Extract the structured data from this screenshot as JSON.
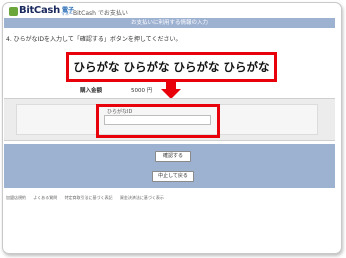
{
  "header": {
    "logo_text": "BitCash",
    "logo_sub_top": "電子",
    "logo_sub_bottom": "マネー",
    "title": "BitCash でお支払い"
  },
  "titlebar": {
    "label": "お支払いに利用する情報の入力"
  },
  "instruction": "4. ひらがなIDを入力して「確認する」ボタンを押してください。",
  "overlay": {
    "text": "ひらがな ひらがな ひらがな ひらがな"
  },
  "purchase": {
    "label": "購入金額",
    "value": "5000 円"
  },
  "form": {
    "id_label": "ひらがなID",
    "id_value": ""
  },
  "buttons": {
    "confirm": "確認する",
    "cancel": "中止して戻る"
  },
  "footer": {
    "links": [
      "加盟店規約",
      "よくある質問",
      "特定商取引法に基づく表記",
      "資金決済法に基づく表示"
    ]
  },
  "colors": {
    "accent_red": "#e8000b",
    "panel_blue": "#9db1d1"
  }
}
